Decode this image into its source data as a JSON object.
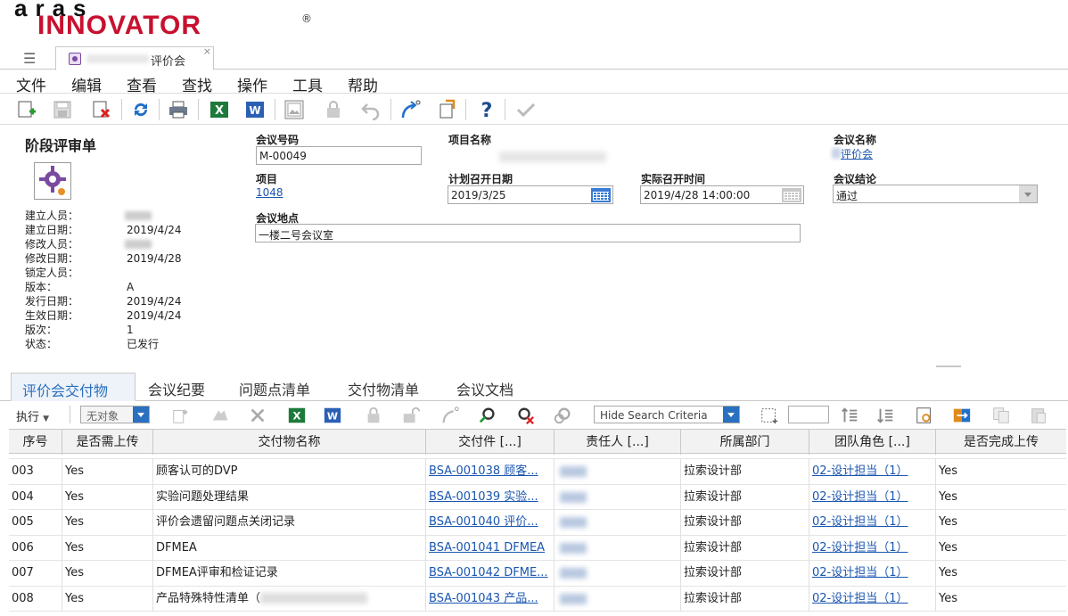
{
  "logo": {
    "line1": "aras",
    "line2": "INNOVATOR",
    "reg": "®"
  },
  "tab": {
    "label": "评价会",
    "close": "×"
  },
  "menu": [
    "文件",
    "编辑",
    "查看",
    "查找",
    "操作",
    "工具",
    "帮助"
  ],
  "form": {
    "title": "阶段评审单",
    "meta": [
      {
        "k": "建立人员：",
        "v": ""
      },
      {
        "k": "建立日期：",
        "v": "2019/4/24"
      },
      {
        "k": "修改人员：",
        "v": ""
      },
      {
        "k": "修改日期：",
        "v": "2019/4/28"
      },
      {
        "k": "锁定人员：",
        "v": ""
      },
      {
        "k": "版本：",
        "v": "A"
      },
      {
        "k": "发行日期：",
        "v": "2019/4/24"
      },
      {
        "k": "生效日期：",
        "v": "2019/4/24"
      },
      {
        "k": "版次：",
        "v": "1"
      },
      {
        "k": "状态：",
        "v": "已发行"
      }
    ],
    "meeting_no_label": "会议号码",
    "meeting_no": "M-00049",
    "project_name_label": "项目名称",
    "meeting_name_label": "会议名称",
    "meeting_name": "评价会",
    "project_label": "项目",
    "project": "1048",
    "planned_date_label": "计划召开日期",
    "planned_date": "2019/3/25",
    "actual_time_label": "实际召开时间",
    "actual_time": "2019/4/28 14:00:00",
    "conclusion_label": "会议结论",
    "conclusion": "通过",
    "location_label": "会议地点",
    "location": "一楼二号会议室"
  },
  "reltabs": [
    "评价会交付物",
    "会议纪要",
    "问题点清单",
    "交付物清单",
    "会议文档"
  ],
  "grid_toolbar": {
    "exec": "执行",
    "no_object": "无对象",
    "hide_search": "Hide Search Criteria"
  },
  "grid": {
    "headers": [
      "序号",
      "是否需上传",
      "交付物名称",
      "交付件 [...]",
      "责任人 [...]",
      "所属部门",
      "团队角色 [...]",
      "是否完成上传"
    ],
    "rows": [
      {
        "no": "003",
        "need": "Yes",
        "name": "顾客认可的DVP",
        "doc": "BSA-001038 顾客...",
        "dept": "拉索设计部",
        "role": "02-设计担当（1）",
        "done": "Yes"
      },
      {
        "no": "004",
        "need": "Yes",
        "name": "实验问题处理结果",
        "doc": "BSA-001039 实验...",
        "dept": "拉索设计部",
        "role": "02-设计担当（1）",
        "done": "Yes"
      },
      {
        "no": "005",
        "need": "Yes",
        "name": "评价会遗留问题点关闭记录",
        "doc": "BSA-001040 评价...",
        "dept": "拉索设计部",
        "role": "02-设计担当（1）",
        "done": "Yes"
      },
      {
        "no": "006",
        "need": "Yes",
        "name": "DFMEA",
        "doc": "BSA-001041 DFMEA",
        "dept": "拉索设计部",
        "role": "02-设计担当（1）",
        "done": "Yes"
      },
      {
        "no": "007",
        "need": "Yes",
        "name": "DFMEA评审和检证记录",
        "doc": "BSA-001042 DFME...",
        "dept": "拉索设计部",
        "role": "02-设计担当（1）",
        "done": "Yes"
      },
      {
        "no": "008",
        "need": "Yes",
        "name": "产品特殊特性清单（",
        "doc": "BSA-001043 产品...",
        "dept": "拉索设计部",
        "role": "02-设计担当（1）",
        "done": "Yes"
      }
    ]
  },
  "colors": {
    "accent": "#2a70c0",
    "link": "#1a56b0",
    "brand_red": "#c8102e"
  }
}
